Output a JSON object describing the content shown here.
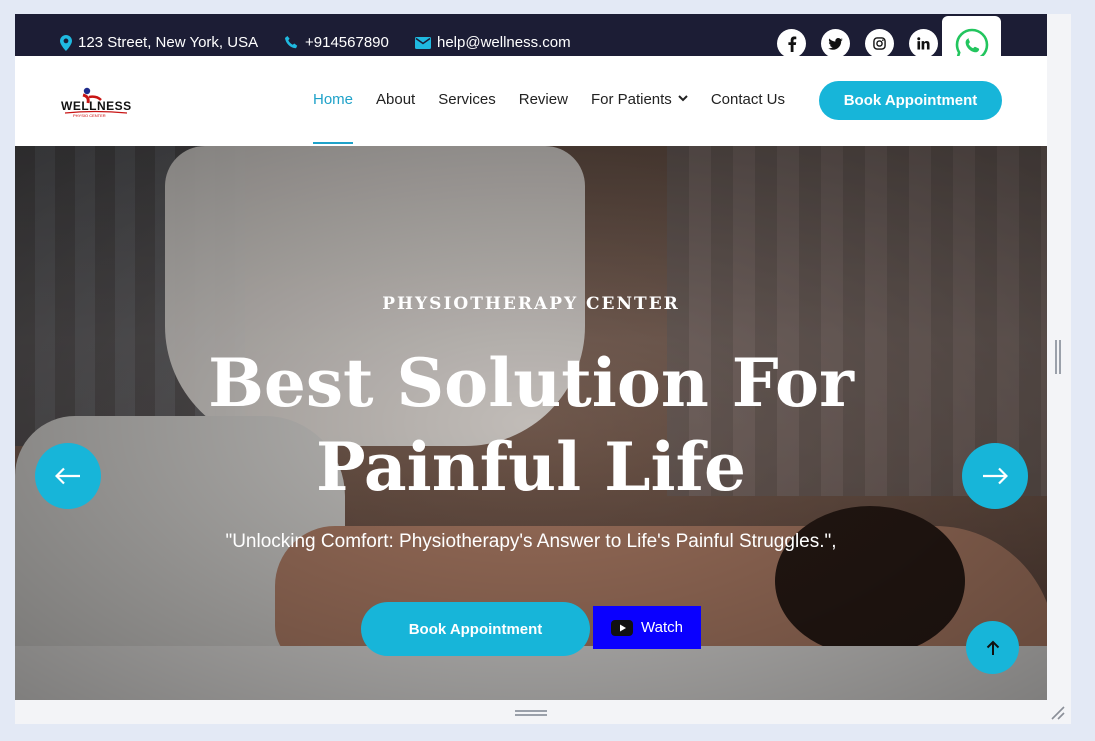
{
  "topbar": {
    "address": "123 Street, New York, USA",
    "phone": "+914567890",
    "email": "help@wellness.com",
    "socials": [
      "facebook-icon",
      "twitter-icon",
      "instagram-icon",
      "linkedin-icon"
    ],
    "whatsapp": "whatsapp-icon"
  },
  "logo": {
    "text": "WELLNESS",
    "subtext": "PHYSIO CENTER"
  },
  "nav": {
    "items": [
      {
        "label": "Home",
        "active": true
      },
      {
        "label": "About"
      },
      {
        "label": "Services"
      },
      {
        "label": "Review"
      },
      {
        "label": "For Patients",
        "dropdown": true
      },
      {
        "label": "Contact Us"
      }
    ],
    "cta": "Book Appointment"
  },
  "hero": {
    "eyebrow": "PHYSIOTHERAPY CENTER",
    "headline_line1": "Best Solution For",
    "headline_line2": "Painful Life",
    "subline": "\"Unlocking Comfort: Physiotherapy's Answer to Life's Painful Struggles.\",",
    "cta": "Book Appointment",
    "watch": "Watch"
  },
  "colors": {
    "accent": "#17b5d9",
    "topbar_bg": "#1c1d35",
    "watch_bg": "#0a00ff",
    "nav_active": "#1fa2c9"
  }
}
